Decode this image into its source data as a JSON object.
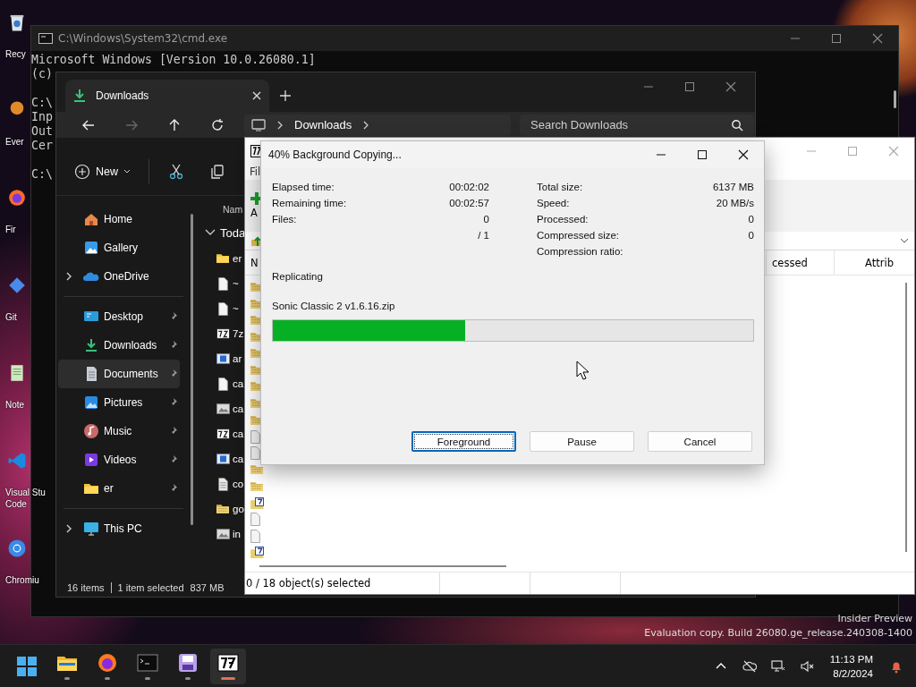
{
  "desktop": {
    "icons": [
      {
        "kind": "recycle",
        "label": "Recy"
      },
      {
        "kind": "shortcut",
        "label": "Ever"
      },
      {
        "kind": "firefox",
        "label": "Fir"
      },
      {
        "kind": "git",
        "label": "Git"
      },
      {
        "kind": "notepad",
        "label": "Note"
      },
      {
        "kind": "vscode",
        "label": "Visual Stu\nCode"
      },
      {
        "kind": "chromium",
        "label": "Chromiu"
      }
    ],
    "watermark": [
      "Insider Preview",
      "Evaluation copy. Build 26080.ge_release.240308-1400"
    ]
  },
  "cmd": {
    "title": "C:\\Windows\\System32\\cmd.exe",
    "blocks": [
      [
        "Microsoft Windows [Version 10.0.26080.1]",
        "(c)"
      ],
      [
        "C:\\",
        "Inp",
        "Out",
        "Cer"
      ],
      [
        "C:\\"
      ]
    ]
  },
  "explorer": {
    "tab": "Downloads",
    "breadcrumb": "Downloads",
    "search": {
      "placeholder": "Search Downloads"
    },
    "new_button": "New",
    "sidebar": [
      [
        {
          "kind": "home",
          "label": "Home",
          "expandable": false,
          "pinned": false,
          "selected": false
        },
        {
          "kind": "gallery",
          "label": "Gallery",
          "expandable": false,
          "pinned": false,
          "selected": false
        },
        {
          "kind": "onedrive",
          "label": "OneDrive",
          "expandable": true,
          "pinned": false,
          "selected": false
        }
      ],
      [
        {
          "kind": "desktop",
          "label": "Desktop",
          "expandable": false,
          "pinned": true,
          "selected": false
        },
        {
          "kind": "downloads",
          "label": "Downloads",
          "expandable": false,
          "pinned": true,
          "selected": false
        },
        {
          "kind": "documents",
          "label": "Documents",
          "expandable": false,
          "pinned": true,
          "selected": true
        },
        {
          "kind": "pictures",
          "label": "Pictures",
          "expandable": false,
          "pinned": true,
          "selected": false
        },
        {
          "kind": "music",
          "label": "Music",
          "expandable": false,
          "pinned": true,
          "selected": false
        },
        {
          "kind": "videos",
          "label": "Videos",
          "expandable": false,
          "pinned": true,
          "selected": false
        },
        {
          "kind": "folder",
          "label": "er",
          "expandable": false,
          "pinned": true,
          "selected": false
        }
      ],
      [
        {
          "kind": "pc",
          "label": "This PC",
          "expandable": true,
          "pinned": false,
          "selected": false
        }
      ]
    ],
    "column": "Nam",
    "group": "Toda",
    "files": [
      {
        "kind": "folder",
        "name": "er"
      },
      {
        "kind": "blank",
        "name": "~"
      },
      {
        "kind": "blank",
        "name": "~"
      },
      {
        "kind": "sevenzip",
        "name": "7z"
      },
      {
        "kind": "media",
        "name": "ar"
      },
      {
        "kind": "blank",
        "name": "ca"
      },
      {
        "kind": "image",
        "name": "ca"
      },
      {
        "kind": "sevenzip",
        "name": "ca"
      },
      {
        "kind": "media",
        "name": "ca"
      },
      {
        "kind": "doc",
        "name": "co"
      },
      {
        "kind": "zip",
        "name": "go"
      },
      {
        "kind": "image",
        "name": "in"
      }
    ],
    "status": [
      "16 items",
      "1 item selected",
      "837 MB"
    ]
  },
  "sevenzip": {
    "menu": "Fil",
    "toolbar_label": "A",
    "columns": [
      "N",
      "cessed",
      "Attrib"
    ],
    "rows": [
      {
        "kind": "zip"
      },
      {
        "kind": "zip"
      },
      {
        "kind": "zip"
      },
      {
        "kind": "zip"
      },
      {
        "kind": "zip"
      },
      {
        "kind": "zip"
      },
      {
        "kind": "zip"
      },
      {
        "kind": "zip"
      },
      {
        "kind": "zip"
      },
      {
        "kind": "blank"
      },
      {
        "kind": "blank"
      },
      {
        "kind": "zip"
      },
      {
        "kind": "zip"
      },
      {
        "kind": "archive"
      },
      {
        "kind": "blank"
      },
      {
        "kind": "blank"
      },
      {
        "kind": "archive"
      }
    ],
    "status": "0 / 18 object(s) selected"
  },
  "dialog": {
    "title": "40% Background Copying...",
    "left_stats": [
      {
        "label": "Elapsed time:",
        "value": "00:02:02"
      },
      {
        "label": "Remaining time:",
        "value": "00:02:57"
      },
      {
        "label": "Files:",
        "value": "0"
      },
      {
        "value": "/ 1"
      }
    ],
    "right_stats": [
      {
        "label": "Total size:",
        "value": "6137 MB"
      },
      {
        "label": "Speed:",
        "value": "20 MB/s"
      },
      {
        "label": "Processed:",
        "value": "0"
      },
      {
        "label": "Compressed size:",
        "value": "0"
      },
      {
        "label": "Compression ratio:"
      }
    ],
    "operation": "Replicating",
    "file": "Sonic Classic 2 v1.6.16.zip",
    "progress": {
      "level": 0.4
    },
    "buttons": [
      {
        "label": "Foreground",
        "focused": true
      },
      {
        "label": "Pause",
        "focused": false
      },
      {
        "label": "Cancel",
        "focused": false
      }
    ]
  },
  "taskbar": {
    "apps": [
      {
        "kind": "start",
        "running": false,
        "active": false
      },
      {
        "kind": "explorer",
        "running": true,
        "active": false
      },
      {
        "kind": "firefox",
        "running": true,
        "active": false
      },
      {
        "kind": "terminal",
        "running": true,
        "active": false
      },
      {
        "kind": "app",
        "running": true,
        "active": false
      },
      {
        "kind": "sevenzip",
        "running": true,
        "active": true
      }
    ],
    "time": "11:13 PM",
    "date": "8/2/2024"
  }
}
